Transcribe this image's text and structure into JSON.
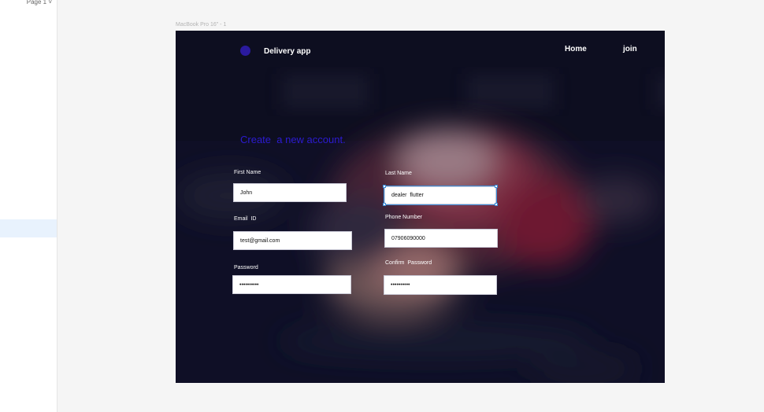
{
  "editor": {
    "page_selector": "Page 1 ˅",
    "frame_label": "MacBook Pro 16\" - 1"
  },
  "app": {
    "brand": "Delivery app",
    "nav": {
      "home": "Home",
      "join": "join"
    },
    "heading": "Create  a new account.",
    "form": {
      "first_name": {
        "label": "First Name",
        "value": "John"
      },
      "last_name": {
        "label": "Last Name",
        "value": "dealer  flutter"
      },
      "email": {
        "label": "Email  ID",
        "value": "test@gmail.com"
      },
      "phone": {
        "label": "Phone Number",
        "value": "07906090000"
      },
      "password": {
        "label": "Password",
        "value": "••••••••••"
      },
      "confirm_password": {
        "label": "Confirm  Password",
        "value": "••••••••••"
      }
    }
  },
  "colors": {
    "frame_bg": "#101124",
    "accent": "#2c1bd1",
    "logo": "#2a1a9e",
    "selection": "#3b8dd9"
  }
}
